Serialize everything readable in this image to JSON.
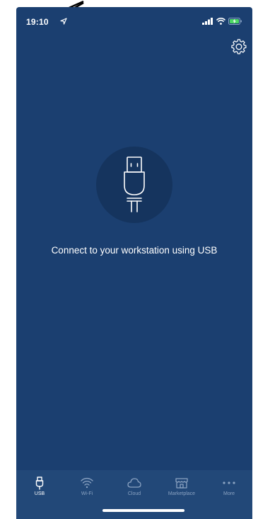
{
  "status_bar": {
    "time": "19:10"
  },
  "main": {
    "connect_message": "Connect to your workstation using USB"
  },
  "tabs": [
    {
      "label": "USB",
      "icon": "usb-icon",
      "active": true
    },
    {
      "label": "Wi-Fi",
      "icon": "wifi-icon",
      "active": false
    },
    {
      "label": "Cloud",
      "icon": "cloud-icon",
      "active": false
    },
    {
      "label": "Marketplace",
      "icon": "marketplace-icon",
      "active": false
    },
    {
      "label": "More",
      "icon": "more-icon",
      "active": false
    }
  ],
  "colors": {
    "background": "#1b3f70",
    "tab_bar": "#224878",
    "usb_circle": "#15345e",
    "active_tab": "#ffffff",
    "inactive_tab": "#8ba3c2"
  }
}
